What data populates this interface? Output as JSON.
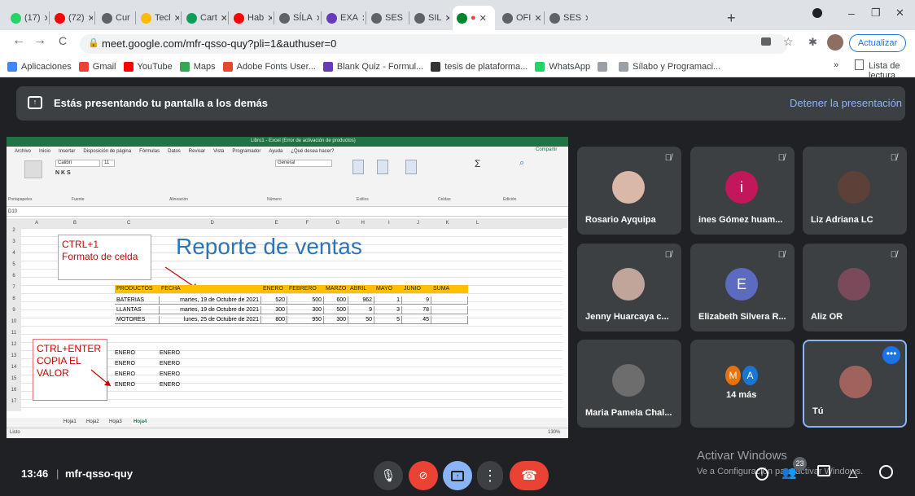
{
  "tabs": [
    {
      "label": "(17)",
      "fav": "whatsapp-icon",
      "color": "#25d366"
    },
    {
      "label": "(72)",
      "fav": "youtube-icon",
      "color": "#ff0000"
    },
    {
      "label": "Cur",
      "fav": "globe-icon",
      "color": "#5f6368"
    },
    {
      "label": "Tecl",
      "fav": "drive-icon",
      "color": "#fbbc04"
    },
    {
      "label": "Cart",
      "fav": "classroom-icon",
      "color": "#0f9d58"
    },
    {
      "label": "Hab",
      "fav": "youtube-icon",
      "color": "#ff0000"
    },
    {
      "label": "SÍLA",
      "fav": "globe-icon",
      "color": "#5f6368"
    },
    {
      "label": "EXA",
      "fav": "forms-icon",
      "color": "#673ab7"
    },
    {
      "label": "SES",
      "fav": "globe-icon",
      "color": "#5f6368"
    },
    {
      "label": "SIL",
      "fav": "globe-icon",
      "color": "#5f6368"
    },
    {
      "label": "●",
      "fav": "meet-icon",
      "color": "#00832d"
    },
    {
      "label": "OFI",
      "fav": "globe-icon",
      "color": "#5f6368"
    },
    {
      "label": "SES",
      "fav": "globe-icon",
      "color": "#5f6368"
    }
  ],
  "new_tab": "+",
  "window": {
    "minimize": "–",
    "maximize": "❐",
    "close": "✕"
  },
  "nav": {
    "back": "←",
    "forward": "→",
    "reload": "C",
    "url": "meet.google.com/mfr-qsso-quy?pli=1&authuser=0",
    "update_label": "Actualizar"
  },
  "bookmarks": [
    {
      "label": "Aplicaciones",
      "color": "#4285f4"
    },
    {
      "label": "Gmail",
      "color": "#ea4335"
    },
    {
      "label": "YouTube",
      "color": "#ff0000"
    },
    {
      "label": "Maps",
      "color": "#34a853"
    },
    {
      "label": "Adobe Fonts User...",
      "color": "#e34a2b"
    },
    {
      "label": "Blank Quiz - Formul...",
      "color": "#673ab7"
    },
    {
      "label": "tesis de plataforma...",
      "color": "#333333"
    },
    {
      "label": "WhatsApp",
      "color": "#25d366"
    },
    {
      "label": "",
      "color": "#9aa0a6"
    },
    {
      "label": "Sílabo y Programaci...",
      "color": "#9aa0a6"
    }
  ],
  "reading_list": "Lista de lectura",
  "more_bookmarks": "»",
  "present": {
    "text": "Estás presentando tu pantalla a los demás",
    "stop": "Detener la presentación"
  },
  "excel": {
    "title": "Libro1 - Excel (Error de activación de productos)",
    "menu": [
      "Archivo",
      "Inicio",
      "Insertar",
      "Disposición de página",
      "Fórmulas",
      "Datos",
      "Revisar",
      "Vista",
      "Programador",
      "Ayuda",
      "¿Qué desea hacer?"
    ],
    "share": "Compartir",
    "font": "Calibri",
    "font_size": "11",
    "number_format": "General",
    "cell_ref": "D10",
    "ribbon_groups": [
      "Portapapeles",
      "Fuente",
      "Alineación",
      "Número",
      "Estilos",
      "Celdas",
      "Edición"
    ],
    "columns": [
      "A",
      "B",
      "C",
      "D",
      "E",
      "F",
      "G",
      "H",
      "I",
      "J",
      "K",
      "L"
    ],
    "rows": [
      "2",
      "3",
      "4",
      "5",
      "6",
      "7",
      "8",
      "9",
      "10",
      "11",
      "12",
      "13",
      "14",
      "15",
      "16",
      "17"
    ],
    "report_title": "Reporte de ventas",
    "note1": [
      "CTRL+1",
      "Formato de celda"
    ],
    "note2": [
      "CTRL+ENTER",
      "COPIA EL",
      "VALOR"
    ],
    "headers": [
      "PRODUCTOS",
      "FECHA",
      "ENERO",
      "FEBRERO",
      "MARZO",
      "ABRIL",
      "MAYO",
      "JUNIO",
      "SUMA"
    ],
    "data": [
      [
        "BATERIAS",
        "martes, 19 de Octubre de 2021",
        "520",
        "500",
        "600",
        "962",
        "1",
        "9",
        ""
      ],
      [
        "LLANTAS",
        "martes, 19 de Octubre de 2021",
        "300",
        "300",
        "500",
        "9",
        "3",
        "78",
        ""
      ],
      [
        "MOTORES",
        "lunes, 25 de Octubre de 2021",
        "800",
        "950",
        "300",
        "50",
        "5",
        "45",
        ""
      ]
    ],
    "enero": [
      "ENERO",
      "ENERO",
      "ENERO",
      "ENERO"
    ],
    "sheets": [
      "Hoja1",
      "Hoja2",
      "Hoja3",
      "Hoja4"
    ],
    "status": "Listo",
    "zoom": "130%"
  },
  "participants": [
    {
      "name": "Rosario Ayquipa",
      "avatar": "photo",
      "color": "#d9b8a8"
    },
    {
      "name": "ines Gómez huam...",
      "avatar": "i",
      "color": "#c2185b"
    },
    {
      "name": "Liz Adriana LC",
      "avatar": "photo",
      "color": "#5d4037"
    },
    {
      "name": "Jenny Huarcaya c...",
      "avatar": "photo",
      "color": "#bfa59a"
    },
    {
      "name": "Elizabeth Silvera R...",
      "avatar": "E",
      "color": "#5c6bc0"
    },
    {
      "name": "Aliz OR",
      "avatar": "photo",
      "color": "#7b4a5a"
    },
    {
      "name": "Maria Pamela Chal...",
      "avatar": "photo",
      "color": "#6d6d6d"
    },
    {
      "name": "14 más",
      "avatar": "MA",
      "color": "#e8710a"
    },
    {
      "name": "Tú",
      "avatar": "photo",
      "color": "#a0625c"
    }
  ],
  "more_avatars": [
    "M",
    "A"
  ],
  "bottom": {
    "time": "13:46",
    "separator": "|",
    "code": "mfr-qsso-quy",
    "badge": "23"
  },
  "windows_activation": {
    "line1": "Activar Windows",
    "line2": "Ve a Configuración para activar Windows."
  }
}
